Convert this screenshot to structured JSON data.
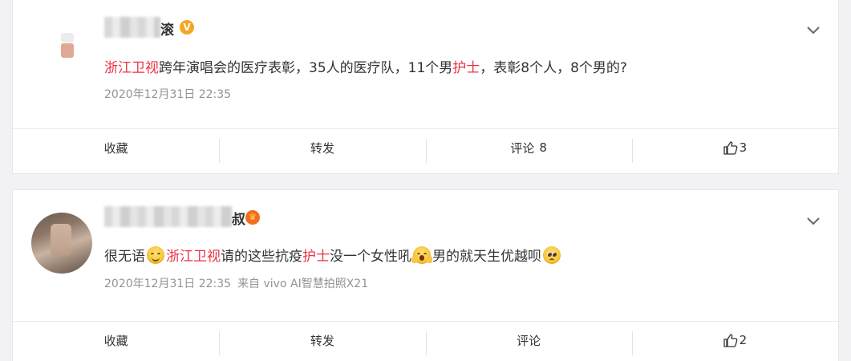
{
  "posts": [
    {
      "author_suffix": "滚",
      "badge": "V",
      "text_parts": [
        {
          "text": "浙江卫视",
          "hl": true
        },
        {
          "text": "跨年演唱会的医疗表彰，35人的医疗队，11个男",
          "hl": false
        },
        {
          "text": "护士",
          "hl": true
        },
        {
          "text": "，表彰8个人，8个男的?",
          "hl": false
        }
      ],
      "timestamp": "2020年12月31日 22:35",
      "source": "",
      "actions": {
        "favorite": "收藏",
        "repost": "转发",
        "comment": "评论",
        "comment_count": "8",
        "like_count": "3"
      }
    },
    {
      "author_suffix": "叔",
      "badge": "crown",
      "text_parts": [
        {
          "text": "很无语",
          "hl": false
        },
        {
          "text": "浙江卫视",
          "hl": true
        },
        {
          "text": "请的这些抗疫",
          "hl": false
        },
        {
          "text": "护士",
          "hl": true
        },
        {
          "text": "没一个女性吼",
          "hl": false
        },
        {
          "text": "男的就天生优越呗",
          "hl": false
        }
      ],
      "emojis": [
        "smile-emoji",
        "shocked-emoji",
        "pleading-emoji"
      ],
      "timestamp": "2020年12月31日 22:35",
      "source": "来自 vivo AI智慧拍照X21",
      "actions": {
        "favorite": "收藏",
        "repost": "转发",
        "comment": "评论",
        "comment_count": "",
        "like_count": "2"
      }
    }
  ],
  "colors": {
    "highlight": "#eb3347",
    "meta": "#939393",
    "text": "#333333",
    "background": "#f2f2f5"
  },
  "icons": [
    "chevron-down-icon",
    "thumbs-up-icon",
    "verified-badge-icon",
    "crown-badge-icon"
  ]
}
